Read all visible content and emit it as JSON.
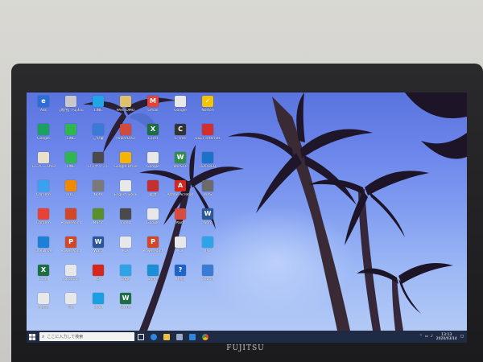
{
  "monitor": {
    "brand": "FUJITSU"
  },
  "desktop": {
    "icons": [
      {
        "label": "Ask",
        "color": "#2b6fd6",
        "symbol": "e"
      },
      {
        "label": "【専用】Fujitsu Connect Notebook",
        "color": "#c9c9c9",
        "symbol": ""
      },
      {
        "label": "LINE",
        "color": "#1fa6e8",
        "symbol": ""
      },
      {
        "label": "PARROMO",
        "color": "#e0c16b",
        "symbol": ""
      },
      {
        "label": "Gmail",
        "color": "#e94235",
        "symbol": "M"
      },
      {
        "label": "Google",
        "color": "#e8e8e8",
        "symbol": ""
      },
      {
        "label": "Norton",
        "color": "#f2c500",
        "symbol": "✓"
      },
      {
        "label": "Google",
        "color": "#1aa260",
        "symbol": ""
      },
      {
        "label": "LINE",
        "color": "#2fb84f",
        "symbol": ""
      },
      {
        "label": "この電",
        "color": "#3a7bd5",
        "symbol": ""
      },
      {
        "label": "PowerDVD",
        "color": "#d14a3a",
        "symbol": ""
      },
      {
        "label": "Excel",
        "color": "#1d6f42",
        "symbol": "X"
      },
      {
        "label": "C-Free",
        "color": "#333",
        "symbol": "C"
      },
      {
        "label": "ESET Internet",
        "color": "#d32f2f",
        "symbol": ""
      },
      {
        "label": "ロールー DVD",
        "color": "#e8e0c8",
        "symbol": ""
      },
      {
        "label": "LINE",
        "color": "#2fb84f",
        "symbol": ""
      },
      {
        "label": "ロックソフト",
        "color": "#4a4a4a",
        "symbol": ""
      },
      {
        "label": "Google Drive",
        "color": "#f4b400",
        "symbol": ""
      },
      {
        "label": "Google",
        "color": "#e8e8e8",
        "symbol": ""
      },
      {
        "label": "WinSCP",
        "color": "#2f8f46",
        "symbol": "W"
      },
      {
        "label": "TEXTREQ",
        "color": "#1a73c9",
        "symbol": ""
      },
      {
        "label": "Chrome",
        "color": "#3aa0f0",
        "symbol": ""
      },
      {
        "label": "VLC",
        "color": "#f08a00",
        "symbol": ""
      },
      {
        "label": "Note",
        "color": "#7a7a7a",
        "symbol": ""
      },
      {
        "label": "English Book",
        "color": "#e8e8e8",
        "symbol": ""
      },
      {
        "label": "電源",
        "color": "#c43030",
        "symbol": ""
      },
      {
        "label": "Adobe Acrobat",
        "color": "#d9261c",
        "symbol": "A"
      },
      {
        "label": "WPS",
        "color": "#6b6b6b",
        "symbol": ""
      },
      {
        "label": "Chrome",
        "color": "#e94235",
        "symbol": ""
      },
      {
        "label": "PowerPoint",
        "color": "#d24726",
        "symbol": ""
      },
      {
        "label": "Music",
        "color": "#5a8f2c",
        "symbol": ""
      },
      {
        "label": "Video",
        "color": "#4a4a4a",
        "symbol": ""
      },
      {
        "label": "Google",
        "color": "#e8e8e8",
        "symbol": ""
      },
      {
        "label": "Paint",
        "color": "#d94b3f",
        "symbol": ""
      },
      {
        "label": "Word",
        "color": "#2b5797",
        "symbol": "W"
      },
      {
        "label": "OneDrive",
        "color": "#1e7fd6",
        "symbol": ""
      },
      {
        "label": "PowerPoint",
        "color": "#d24726",
        "symbol": "P"
      },
      {
        "label": "Word",
        "color": "#2b579a",
        "symbol": "W"
      },
      {
        "label": "PDF",
        "color": "#e8e8e8",
        "symbol": ""
      },
      {
        "label": "PowerPoint",
        "color": "#d24726",
        "symbol": "P"
      },
      {
        "label": "PDF",
        "color": "#e8e8e8",
        "symbol": ""
      },
      {
        "label": "PC",
        "color": "#2fa3e8",
        "symbol": ""
      },
      {
        "label": "Excel",
        "color": "#1d6f42",
        "symbol": "X"
      },
      {
        "label": "Notebook",
        "color": "#e8e8e8",
        "symbol": ""
      },
      {
        "label": "PDF",
        "color": "#d9261c",
        "symbol": ""
      },
      {
        "label": "Edge",
        "color": "#2fa3e8",
        "symbol": ""
      },
      {
        "label": "Share",
        "color": "#1a8fd6",
        "symbol": ""
      },
      {
        "label": "Help",
        "color": "#1f63c9",
        "symbol": "?"
      },
      {
        "label": "Sound",
        "color": "#3a7bd5",
        "symbol": ""
      },
      {
        "label": "Media",
        "color": "#e8e8e8",
        "symbol": ""
      },
      {
        "label": "File",
        "color": "#e8e8e8",
        "symbol": ""
      },
      {
        "label": "Cloud",
        "color": "#1aa0e0",
        "symbol": ""
      },
      {
        "label": "Game",
        "color": "#1d6f42",
        "symbol": "W"
      }
    ]
  },
  "taskbar": {
    "search_placeholder": "ここに入力して検索",
    "time": "13:13",
    "date": "2020/03/14",
    "pinned": [
      {
        "name": "task-view",
        "color": "#ffffff"
      },
      {
        "name": "edge",
        "color": "#2f86e0"
      },
      {
        "name": "file-explorer",
        "color": "#f0c040"
      },
      {
        "name": "store",
        "color": "#9aa9c9"
      },
      {
        "name": "mail",
        "color": "#2f86e0"
      },
      {
        "name": "chrome",
        "color": "#e94235"
      }
    ]
  }
}
